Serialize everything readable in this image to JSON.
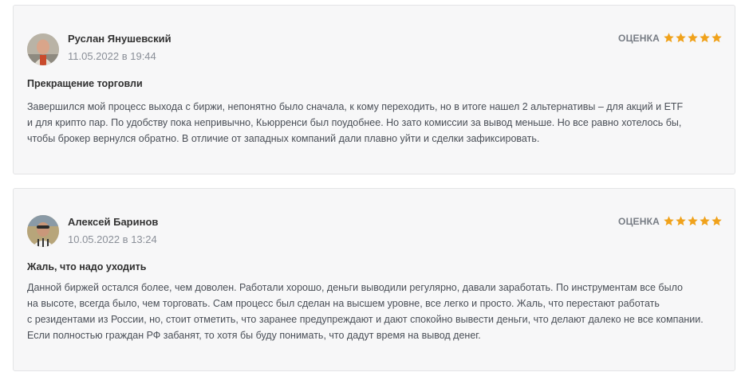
{
  "rating_label": "ОЦЕНКА",
  "star_color": "#f0a21b",
  "reviews": [
    {
      "author": "Руслан Янушевский",
      "date": "11.05.2022 в 19:44",
      "rating": 5,
      "title": "Прекращение торговли",
      "lines": [
        "Завершился мой процесс выхода с биржи, непонятно было сначала, к кому переходить, но в итоге нашел 2 альтернативы – для акций и ETF",
        "и для крипто пар. По удобству пока непривычно, Кьюрренси был поудобнее. Но зато комиссии за вывод меньше. Но все равно хотелось бы,",
        "чтобы брокер вернулся обратно. В отличие от западных компаний дали плавно уйти и сделки зафиксировать."
      ]
    },
    {
      "author": "Алексей Баринов",
      "date": "10.05.2022 в 13:24",
      "rating": 5,
      "title": "Жаль, что надо уходить",
      "lines": [
        "Данной биржей остался более, чем доволен. Работали хорошо, деньги выводили регулярно, давали заработать. По инструментам все было",
        "на высоте, всегда было, чем торговать. Сам процесс был сделан на высшем уровне, все легко и просто. Жаль, что перестают работать",
        "с резидентами из России, но, стоит отметить, что заранее предупреждают и дают спокойно вывести деньги, что делают далеко не все компании.",
        "Если полностью граждан РФ забанят, то хотя бы буду понимать, что дадут время на вывод денег."
      ]
    }
  ]
}
